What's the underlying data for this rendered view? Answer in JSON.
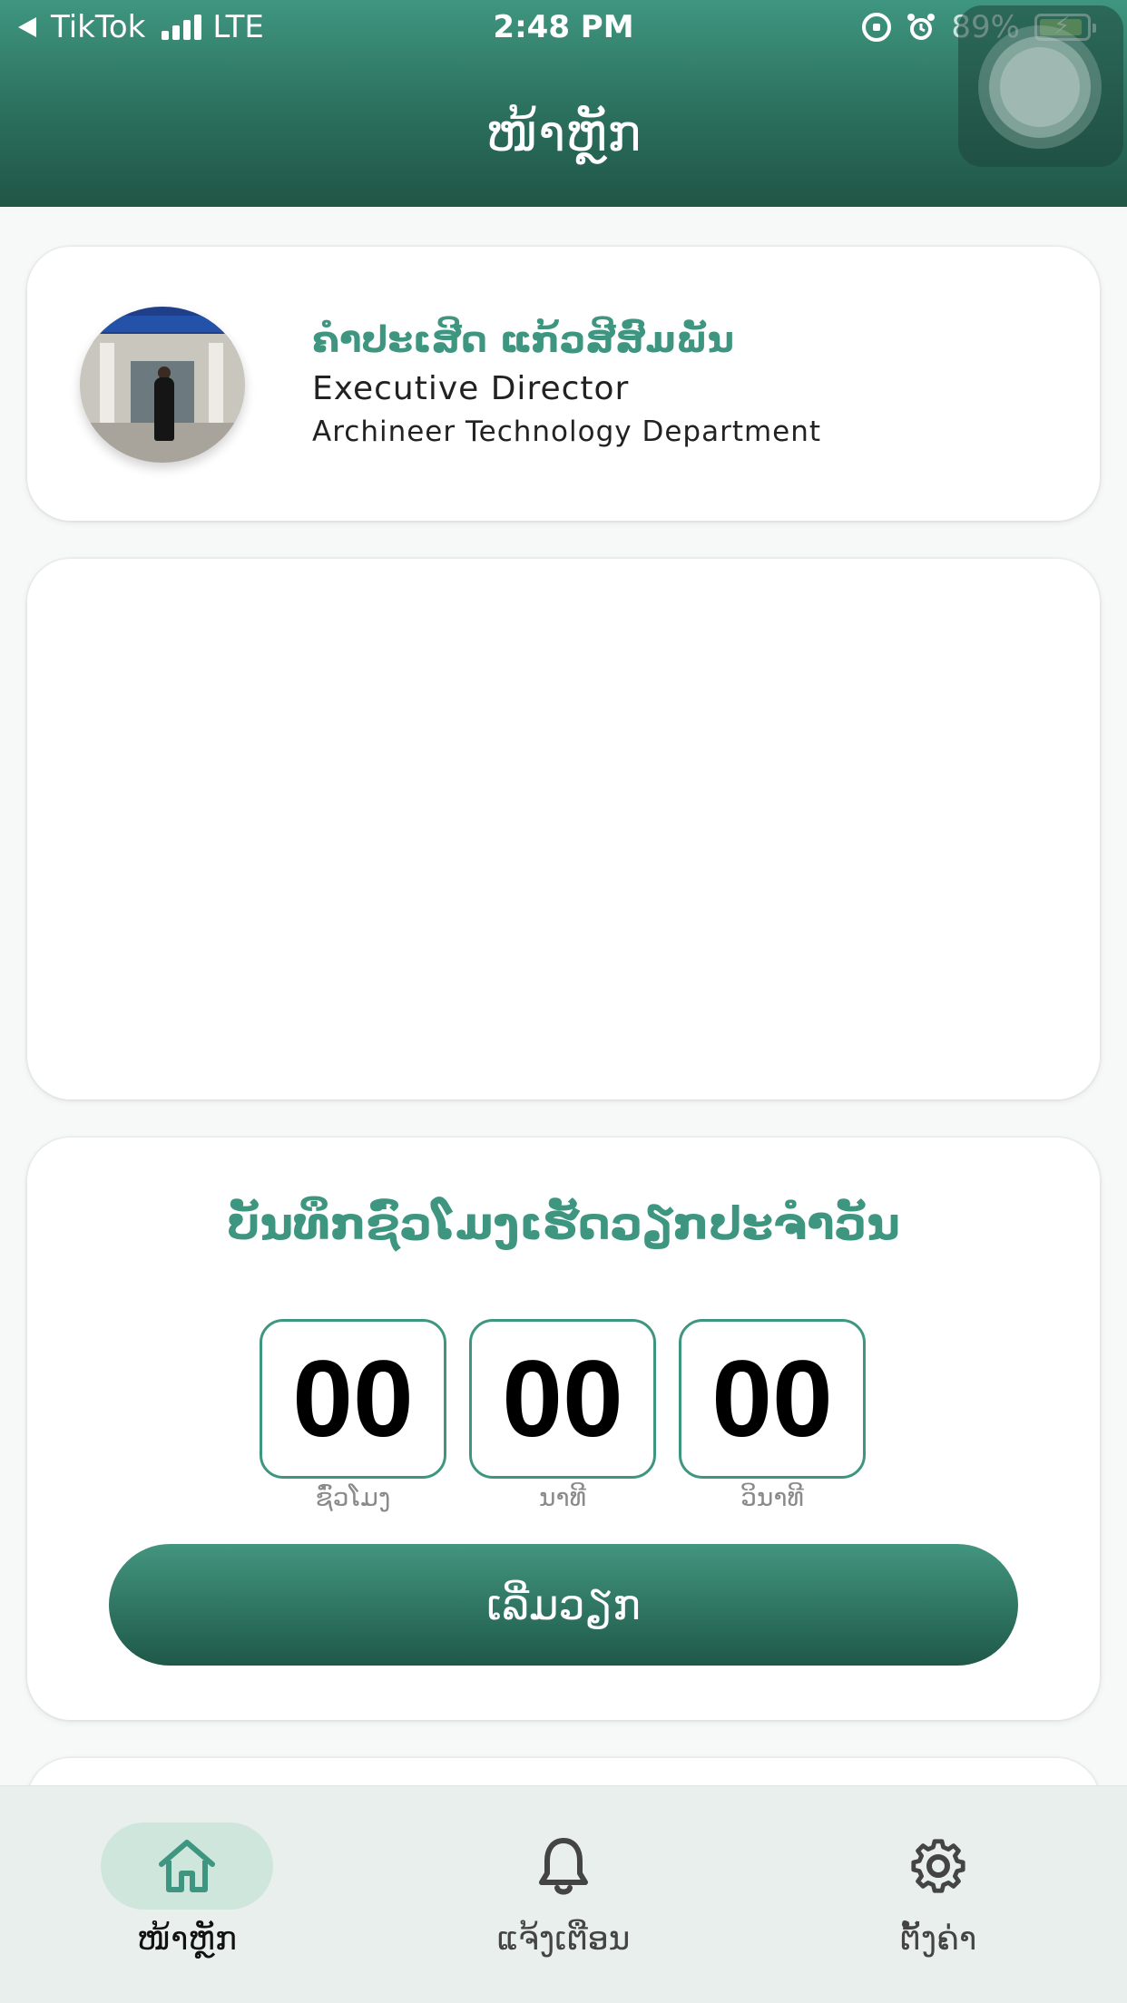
{
  "status_bar": {
    "back_app": "TikTok",
    "network": "LTE",
    "time": "2:48 PM",
    "battery_percent": "89%",
    "icons": [
      "back-arrow-icon",
      "signal-bars-icon",
      "orientation-lock-icon",
      "alarm-icon",
      "battery-charging-icon"
    ]
  },
  "header": {
    "title": "ໜ້າຫຼັກ"
  },
  "profile": {
    "name": "ຄຳປະເສີດ ແກ້ວສີສົມພັນ",
    "role": "Executive Director",
    "department": "Archineer Technology Department"
  },
  "timer": {
    "title": "ບັນທຶກຊົ່ວໂມງເຮັດວຽກປະຈຳວັນ",
    "hours": "00",
    "minutes": "00",
    "seconds": "00",
    "hours_label": "ຊົ່ວໂມງ",
    "minutes_label": "ນາທີ",
    "seconds_label": "ວິນາທີ",
    "start_button": "ເລີ່ມວຽກ"
  },
  "tabs": [
    {
      "label": "ໜ້າຫຼັກ",
      "icon": "home-icon",
      "active": true
    },
    {
      "label": "ແຈ້ງເຕືອນ",
      "icon": "bell-icon",
      "active": false
    },
    {
      "label": "ຕັ້ງຄ່າ",
      "icon": "gear-icon",
      "active": false
    }
  ],
  "colors": {
    "brand_green": "#3f9680",
    "header_dark": "#205646",
    "active_tab_pill": "#cfe6dd",
    "tabbar_bg": "#e8efec"
  }
}
